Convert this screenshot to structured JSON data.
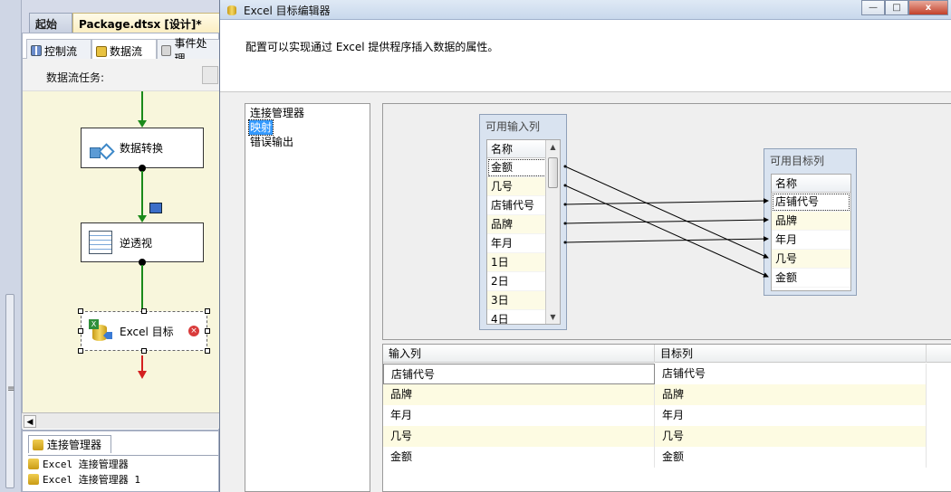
{
  "ide": {
    "doc_tabs": {
      "start": "起始页",
      "package": "Package.dtsx [设计]*"
    },
    "design_tabs": {
      "control_flow": "控制流",
      "data_flow": "数据流",
      "event_handlers": "事件处理"
    },
    "data_flow_task_label": "数据流任务:",
    "nodes": {
      "convert": "数据转换",
      "unpivot": "逆透视",
      "excel_dest": "Excel 目标"
    },
    "connection_manager": {
      "tab_label": "连接管理器",
      "items": [
        "Excel 连接管理器",
        "Excel 连接管理器 1"
      ]
    }
  },
  "dialog": {
    "title": "Excel 目标编辑器",
    "description": "配置可以实现通过 Excel 提供程序插入数据的属性。",
    "nav": [
      "连接管理器",
      "映射",
      "错误输出"
    ],
    "nav_selected": 1,
    "input_box": {
      "title": "可用输入列",
      "header": "名称",
      "columns": [
        "金额",
        "几号",
        "店铺代号",
        "品牌",
        "年月",
        "1日",
        "2日",
        "3日",
        "4日"
      ]
    },
    "dest_box": {
      "title": "可用目标列",
      "header": "名称",
      "columns": [
        "店铺代号",
        "品牌",
        "年月",
        "几号",
        "金额"
      ]
    },
    "mapping_lines": [
      {
        "from": "金额",
        "to": "几号"
      },
      {
        "from": "几号",
        "to": "金额"
      },
      {
        "from": "店铺代号",
        "to": "店铺代号"
      },
      {
        "from": "品牌",
        "to": "品牌"
      },
      {
        "from": "年月",
        "to": "年月"
      }
    ],
    "grid": {
      "headers": [
        "输入列",
        "目标列"
      ],
      "rows": [
        [
          "店铺代号",
          "店铺代号"
        ],
        [
          "品牌",
          "品牌"
        ],
        [
          "年月",
          "年月"
        ],
        [
          "几号",
          "几号"
        ],
        [
          "金额",
          "金额"
        ]
      ]
    },
    "window_buttons": {
      "min": "—",
      "max": "□",
      "close": "x"
    }
  }
}
